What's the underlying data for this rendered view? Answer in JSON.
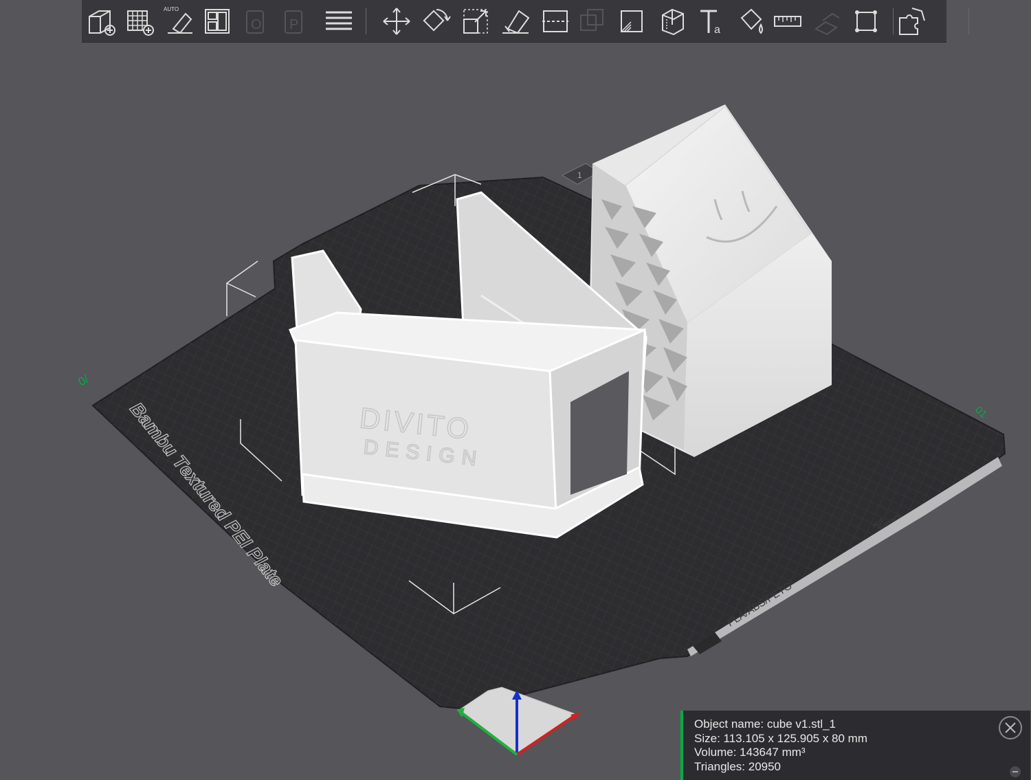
{
  "toolbar": {
    "buttons": [
      {
        "name": "add-cube-icon"
      },
      {
        "name": "add-plate-icon"
      },
      {
        "name": "auto-orient-icon",
        "badge": "AUTO"
      },
      {
        "name": "arrange-icon"
      },
      {
        "name": "split-objects-icon"
      },
      {
        "name": "split-parts-icon"
      },
      {
        "name": "layers-icon"
      },
      {
        "name": "move-icon"
      },
      {
        "name": "rotate-icon"
      },
      {
        "name": "scale-icon"
      },
      {
        "name": "lay-on-face-icon"
      },
      {
        "name": "cut-icon"
      },
      {
        "name": "mesh-boolean-icon"
      },
      {
        "name": "support-paint-icon"
      },
      {
        "name": "seam-paint-icon"
      },
      {
        "name": "text-icon"
      },
      {
        "name": "color-paint-icon"
      },
      {
        "name": "measure-icon"
      },
      {
        "name": "assembly-icon"
      },
      {
        "name": "fit-view-icon"
      },
      {
        "name": "puzzle-icon"
      }
    ]
  },
  "plate": {
    "label": "Bambu Textured PEI Plate",
    "strip_label": "PLA/ABS/PETG",
    "hot_surface_line1": "HOT",
    "hot_surface_line2": "SURFACE",
    "origin_marker": "0/",
    "end_marker": "01",
    "plate_number": "1"
  },
  "model": {
    "emboss_line1": "DIVITO",
    "emboss_line2": "DESIGN"
  },
  "info": {
    "object_name": "Object name: cube v1.stl_1",
    "size": "Size: 113.105 x 125.905 x 80 mm",
    "volume": "Volume: 143647 mm³",
    "triangles": "Triangles: 20950"
  },
  "colors": {
    "background": "#55555a",
    "toolbar": "#38383c",
    "bed": "#2d2d30",
    "accent": "#00ae42",
    "axis_x": "#d42020",
    "axis_y": "#20b040",
    "axis_z": "#1830c8"
  }
}
